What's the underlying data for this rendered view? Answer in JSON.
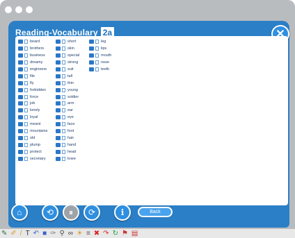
{
  "window": {
    "title": "Reading-Vocabulary",
    "unit": "2a",
    "close_icon": "✕"
  },
  "columns": [
    [
      "beard",
      "brothers",
      "business",
      "dreamy",
      "engineers",
      "file",
      "fly",
      "forbidden",
      "force",
      "job",
      "lonely",
      "loyal",
      "meant",
      "mountains",
      "old",
      "plump",
      "protect",
      "secretary"
    ],
    [
      "short",
      "skin",
      "special",
      "strong",
      "suit",
      "tall",
      "thin",
      "young",
      "soldier",
      "arm",
      "ear",
      "eye",
      "face",
      "foot",
      "hair",
      "hand",
      "head",
      "knee"
    ],
    [
      "leg",
      "lips",
      "mouth",
      "nose",
      "teeth"
    ]
  ],
  "controls": {
    "back_label": "Back"
  },
  "icons": {
    "home": "home-icon",
    "prev": "arrow-left-icon",
    "pause": "pause-icon",
    "next": "arrow-right-icon",
    "info": "info-icon"
  },
  "colors": {
    "accent": "#2b7fc6",
    "word_text": "#1f3d6b"
  }
}
